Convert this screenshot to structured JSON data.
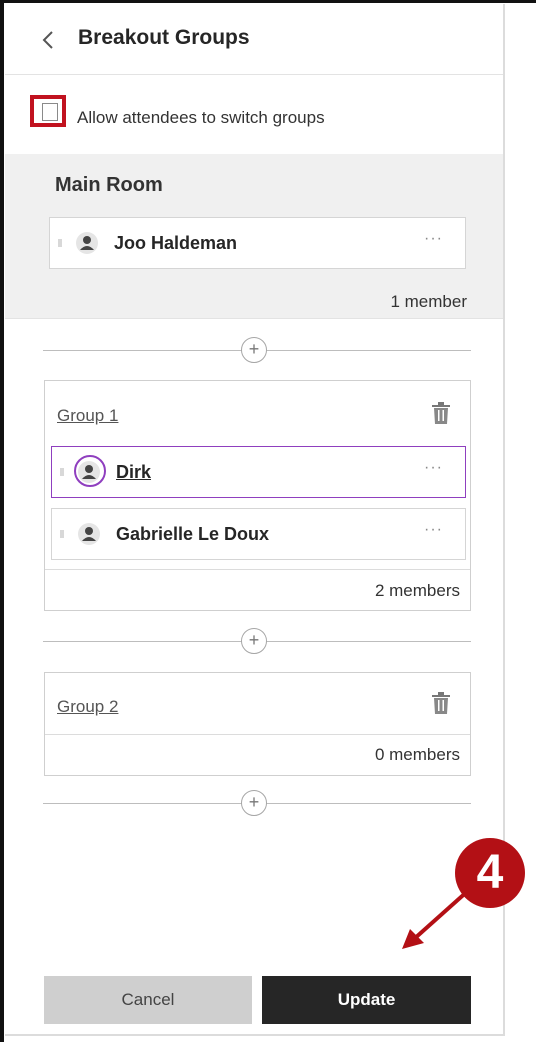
{
  "header": {
    "title": "Breakout Groups"
  },
  "settings": {
    "switch_label": "Allow attendees to switch groups",
    "switch_checked": false
  },
  "main_room": {
    "title": "Main Room",
    "members": [
      {
        "name": "Joo Haldeman"
      }
    ],
    "count": "1 member"
  },
  "groups": [
    {
      "title": "Group 1",
      "members": [
        {
          "name": "Dirk",
          "selected": true
        },
        {
          "name": "Gabrielle Le Doux",
          "selected": false
        }
      ],
      "count": "2 members"
    },
    {
      "title": "Group 2",
      "members": [],
      "count": "0 members"
    }
  ],
  "more_label": "···",
  "add_label": "+",
  "footer": {
    "cancel_label": "Cancel",
    "update_label": "Update"
  },
  "annotation": {
    "step": "4"
  },
  "colors": {
    "accent_purple": "#8f3fbf",
    "highlight_red": "#c1121f",
    "callout_red": "#b31015",
    "update_bg": "#262626"
  }
}
